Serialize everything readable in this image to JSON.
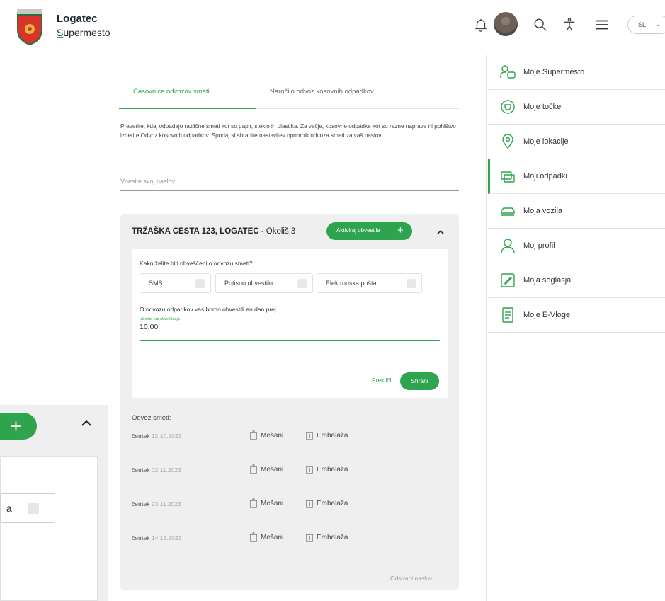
{
  "header": {
    "brand_title": "Logatec",
    "brand_sub": "Supermesto",
    "language": "SL"
  },
  "menu": {
    "items": [
      {
        "label": "Moje Supermesto",
        "icon": "people-icon"
      },
      {
        "label": "Moje točke",
        "icon": "badge-icon"
      },
      {
        "label": "Moje lokacije",
        "icon": "location-pin-icon"
      },
      {
        "label": "Moji odpadki",
        "icon": "waste-bin-icon",
        "active": true
      },
      {
        "label": "Moja vozila",
        "icon": "car-icon"
      },
      {
        "label": "Moj profil",
        "icon": "user-icon"
      },
      {
        "label": "Moja soglasja",
        "icon": "consent-icon"
      },
      {
        "label": "Moje E-Vloge",
        "icon": "document-icon"
      }
    ]
  },
  "tabs": {
    "active": "Časovnice odvozov smeti",
    "other": "Naročilo odvoz kosovnih odpadkov"
  },
  "intro_text": "Preverite, kdaj odpadajo različne smeti kot so papir, steklo in plastika. Za večje, kosovne odpadke kot so razne naprave ni pohištvo izberite Odvoz kosovnih odpadkov. Spodaj si shranite nastavitev opomnik odvoza smeti za vaš naslov.",
  "address_input": {
    "placeholder": "Vnesite svoj naslov"
  },
  "card": {
    "address": "TRŽAŠKA CESTA 123, LOGATEC",
    "district": " - Okoliš 3",
    "notify_button": "Aktiviraj obvestila",
    "question": "Kako želite biti obveščeni o odvozu smeti?",
    "options": [
      "SMS",
      "Potisno obvestilo",
      "Elektronska pošta"
    ],
    "info": "O odvozu odpadkov vas bomo obvestili en dan prej.",
    "time_label": "Izberite uro obveščanja",
    "time_value": "10:00",
    "cancel": "Prekliči",
    "save": "Shrani",
    "schedule_title": "Odvoz smeti:",
    "schedule": [
      {
        "day": "četrtek",
        "date": "12.10.2023",
        "waste_a": "Mešani",
        "waste_b": "Embalaža"
      },
      {
        "day": "četrtek",
        "date": "02.11.2023",
        "waste_a": "Mešani",
        "waste_b": "Embalaža"
      },
      {
        "day": "četrtek",
        "date": "23.11.2023",
        "waste_a": "Mešani",
        "waste_b": "Embalaža"
      },
      {
        "day": "četrtek",
        "date": "14.12.2023",
        "waste_a": "Mešani",
        "waste_b": "Embalaža"
      }
    ],
    "remove": "Odstrani naslov"
  },
  "left_card": {
    "select_text": "a"
  },
  "colors": {
    "accent": "#2ea44f",
    "card_bg": "#efefef"
  }
}
